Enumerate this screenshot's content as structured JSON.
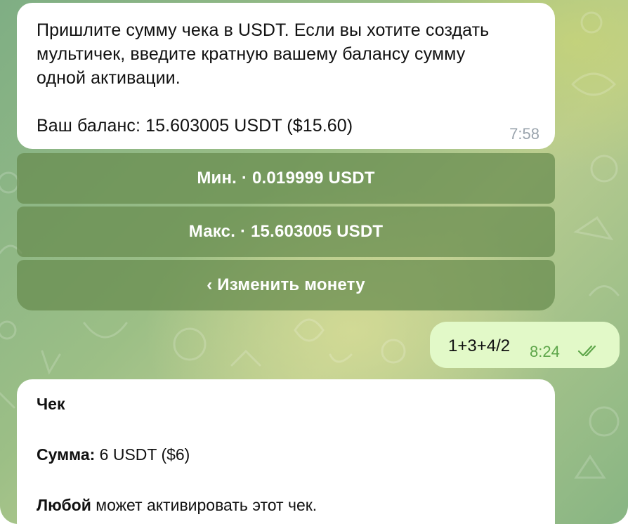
{
  "messages": {
    "incoming1": {
      "text": "Пришлите сумму чека в USDT. Если вы хотите создать\nмультичек, введите кратную вашему балансу сумму\nодной активации.\n\nВаш баланс: 15.603005 USDT ($15.60)",
      "time": "7:58"
    },
    "keyboard": {
      "min_label": "Мин. · 0.019999 USDT",
      "max_label": "Макс. · 15.603005 USDT",
      "change_coin_label": "‹ Изменить монету"
    },
    "outgoing1": {
      "text": "1+3+4/2",
      "time": "8:24",
      "status_icon": "double-check-icon"
    },
    "incoming2": {
      "title": "Чек",
      "amount_label": "Сумма:",
      "amount_value": " 6 USDT ($6)",
      "anyone_label": "Любой",
      "anyone_text": " может активировать этот чек."
    }
  },
  "colors": {
    "incoming_bubble": "#ffffff",
    "outgoing_bubble": "#e2f9c8",
    "keyboard_button": "#668a4e",
    "outgoing_time": "#5ea64a",
    "incoming_time": "#9aa4ad"
  }
}
